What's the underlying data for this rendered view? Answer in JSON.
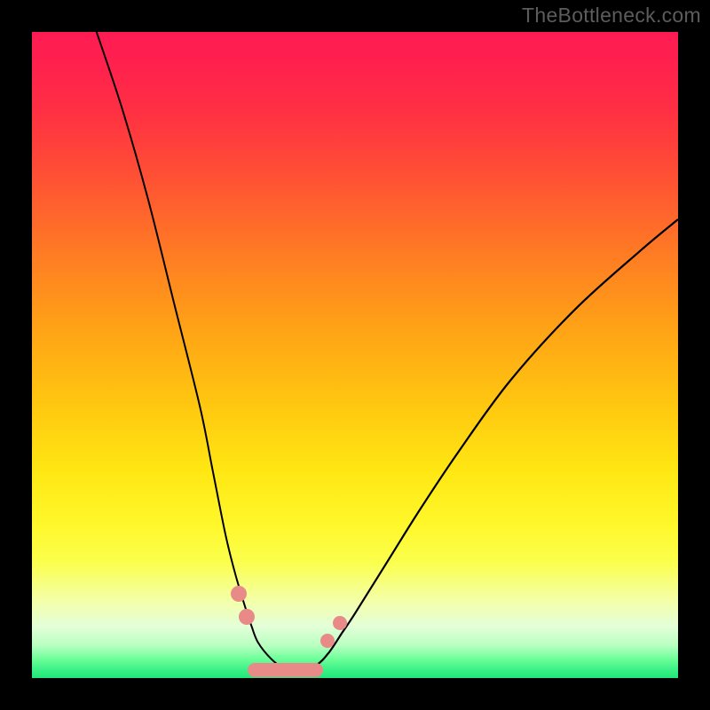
{
  "watermark": "TheBottleneck.com",
  "palette": {
    "dot_color": "#e88a88",
    "curve_color": "#000000"
  },
  "chart_data": {
    "type": "line",
    "title": "",
    "xlabel": "",
    "ylabel": "",
    "xlim": [
      0,
      100
    ],
    "ylim": [
      0,
      100
    ],
    "series": [
      {
        "name": "left-curve",
        "x": [
          10,
          14,
          18,
          22,
          26,
          28,
          30,
          31.5,
          33,
          34,
          35,
          37,
          39,
          41
        ],
        "y": [
          100,
          88,
          74,
          58,
          42,
          32,
          22,
          16,
          11,
          8,
          5.5,
          3,
          1.5,
          1
        ]
      },
      {
        "name": "right-curve",
        "x": [
          41,
          44,
          46,
          48,
          50,
          55,
          60,
          66,
          74,
          84,
          94,
          100
        ],
        "y": [
          1,
          2,
          4,
          7,
          10,
          18,
          26,
          35,
          46,
          57,
          66,
          71
        ]
      }
    ],
    "optimal_markers": {
      "left_dots": [
        {
          "x": 32.0,
          "y": 13.0,
          "r": 9
        },
        {
          "x": 33.2,
          "y": 9.5,
          "r": 9
        }
      ],
      "right_dots": [
        {
          "x": 45.8,
          "y": 5.8,
          "r": 8
        },
        {
          "x": 47.6,
          "y": 8.5,
          "r": 8
        }
      ],
      "bottom_bar": {
        "x0": 34.5,
        "x1": 44.0,
        "y": 1.3,
        "thickness": 16
      }
    }
  }
}
